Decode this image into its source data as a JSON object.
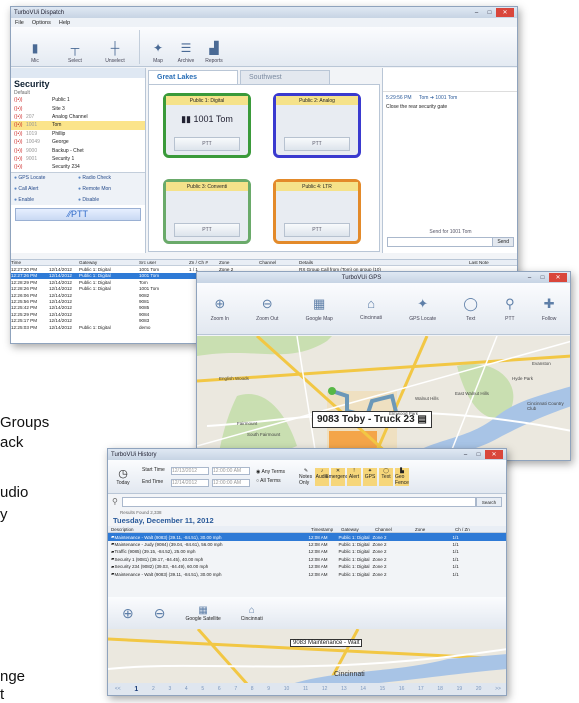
{
  "left_text": [
    "Groups",
    "ack",
    "udio",
    "y",
    "nge",
    "t"
  ],
  "dispatch": {
    "title": "TurboVUi Dispatch",
    "menu": [
      "File",
      "Options",
      "Help"
    ],
    "ribbon": [
      "Mic",
      "Select",
      "Unselect",
      "Map",
      "Archive",
      "Reports"
    ],
    "sidebar": {
      "title": "Security",
      "sub": "Default",
      "rows": [
        [
          "",
          "Public 1"
        ],
        [
          "",
          "Site 3"
        ],
        [
          "207",
          "Analog Channel"
        ],
        [
          "1001",
          "Tom"
        ],
        [
          "1019",
          "Phillip"
        ],
        [
          "10049",
          "George"
        ],
        [
          "9000",
          "Backup - Chet"
        ],
        [
          "9001",
          "Security 1"
        ],
        [
          "",
          "Security 234"
        ]
      ],
      "buttons": [
        "GPS Locate",
        "Radio Check",
        "Call Alert",
        "Remote Mon",
        "Enable",
        "Disable"
      ],
      "ptt": "PTT"
    },
    "tabs": [
      "Great Lakes",
      "Southwest"
    ],
    "channels": [
      {
        "name": "Public 1: Digital",
        "talk": "1001 Tom",
        "ptt": "PTT",
        "color": "#3a9a3a"
      },
      {
        "name": "Public 2: Analog",
        "talk": "",
        "ptt": "PTT",
        "color": "#3a3acf"
      },
      {
        "name": "Public 3: Conventi",
        "talk": "",
        "ptt": "PTT",
        "color": "#6aaa6a"
      },
      {
        "name": "Public 4: LTR",
        "talk": "",
        "ptt": "PTT",
        "color": "#e38a2a"
      }
    ],
    "right": {
      "msg_time": "5:29:56 PM",
      "msg_from": "Tom",
      "msg_to": "1001 Tom",
      "msg_text": "Close the rear security gate",
      "send_label": "Send for 1001 Tom",
      "send_btn": "Send"
    },
    "log": {
      "headers": [
        "Time",
        "",
        "Gateway",
        "Src user",
        "Zn / Ch #",
        "Zone",
        "Channel",
        "Details",
        "Last Note"
      ],
      "rows": [
        [
          "12:27:20 PM",
          "12/14/2012",
          "Public 1: Digital",
          "1001 Tom",
          "1 / 1",
          "Zone 2",
          "",
          "RX Group Call from (Tom) on group (10)"
        ],
        [
          "12:27:26 PM",
          "12/14/2012",
          "Public 1: Digital",
          "1001 Tom",
          "",
          "",
          "",
          "",
          "sel"
        ],
        [
          "12:28:29 PM",
          "12/14/2012",
          "Public 1: Digital",
          "Tom",
          "",
          "",
          "",
          ""
        ],
        [
          "12:28:26 PM",
          "12/14/2012",
          "Public 1: Digital",
          "1001 Tom",
          "",
          "",
          "",
          ""
        ],
        [
          "12:26:06 PM",
          "12/14/2012",
          "",
          "9082",
          "",
          "",
          "",
          ""
        ],
        [
          "12:25:56 PM",
          "12/14/2012",
          "",
          "9081",
          "",
          "",
          "",
          ""
        ],
        [
          "12:25:42 PM",
          "12/14/2012",
          "",
          "9085",
          "",
          "",
          "",
          ""
        ],
        [
          "12:25:29 PM",
          "12/14/2012",
          "",
          "9084",
          "",
          "",
          "",
          ""
        ],
        [
          "12:25:17 PM",
          "12/14/2012",
          "",
          "9083",
          "",
          "",
          "",
          ""
        ],
        [
          "12:25:03 PM",
          "12/14/2012",
          "Public 1: Digital",
          "demo",
          "",
          "",
          "",
          ""
        ]
      ]
    }
  },
  "gps": {
    "title": "TurboVUi GPS",
    "tools": [
      "Zoom In",
      "Zoom Out",
      "Google Map",
      "Cincinnati",
      "GPS Locate",
      "Text",
      "PTT",
      "Follow"
    ],
    "label": "9083 Toby - Truck 23",
    "places": [
      "Evanston",
      "Hyde Park",
      "East Walnut Hills",
      "Walnut Hills",
      "Cincinnati Country Club",
      "English Woods",
      "Fairmount",
      "South Fairmount",
      "Elmwood Park"
    ]
  },
  "history": {
    "title": "TurboVUi History",
    "start_label": "Start Time",
    "end_label": "End Time",
    "start_date": "12/13/2012",
    "end_date": "12/14/2012",
    "start_time": "12:00:00 AM",
    "end_time": "12:00:00 AM",
    "any_terms": "Any Terms",
    "all_terms": "All Terms",
    "today": "Today",
    "filters": [
      "Notes Only",
      "Audio",
      "Emergency",
      "Alert",
      "GPS",
      "Text",
      "Geo Fence"
    ],
    "search": "Search",
    "results": "Results Found  2,338",
    "date": "Tuesday, December 11, 2012",
    "headers": [
      "Description",
      "Timestamp",
      "Gateway",
      "Channel",
      "Zone",
      "Ch / Zn"
    ],
    "rows": [
      [
        "Maintenance - Walt (9083)   (39.11, -84.51), 30.00 mph",
        "12:08 AM",
        "Public 1: Digital",
        "Zone 2",
        "",
        "1/1",
        "sel"
      ],
      [
        "Maintenance - Judy (9084)   (39.04, -84.61), 56.00 mph",
        "12:08 AM",
        "Public 1: Digital",
        "Zone 2",
        "",
        "1/1"
      ],
      [
        "Traffic (9085)   (39.15, -84.52), 25.00 mph",
        "12:08 AM",
        "Public 1: Digital",
        "Zone 2",
        "",
        "1/1"
      ],
      [
        "Security 1 (9081)   (39.17, -84.45), 40.00 mph",
        "12:08 AM",
        "Public 1: Digital",
        "Zone 2",
        "",
        "1/1"
      ],
      [
        "Security 234 (9082)   (39.03, -84.49), 60.00 mph",
        "12:08 AM",
        "Public 1: Digital",
        "Zone 2",
        "",
        "1/1"
      ],
      [
        "Maintenance - Walt (9083)   (39.11, -84.51), 30.00 mph",
        "12:08 AM",
        "Public 1: Digital",
        "Zone 2",
        "",
        "1/1"
      ]
    ],
    "map_tools": [
      "Google Satellite",
      "Cincinnati"
    ],
    "map_label": "9083 Maintenance - Walt",
    "map_city": "Cincinnati",
    "pages": [
      "<<",
      "1",
      "2",
      "3",
      "4",
      "5",
      "6",
      "7",
      "8",
      "9",
      "10",
      "11",
      "12",
      "13",
      "14",
      "15",
      "16",
      "17",
      "18",
      "19",
      "20",
      ">>"
    ]
  }
}
